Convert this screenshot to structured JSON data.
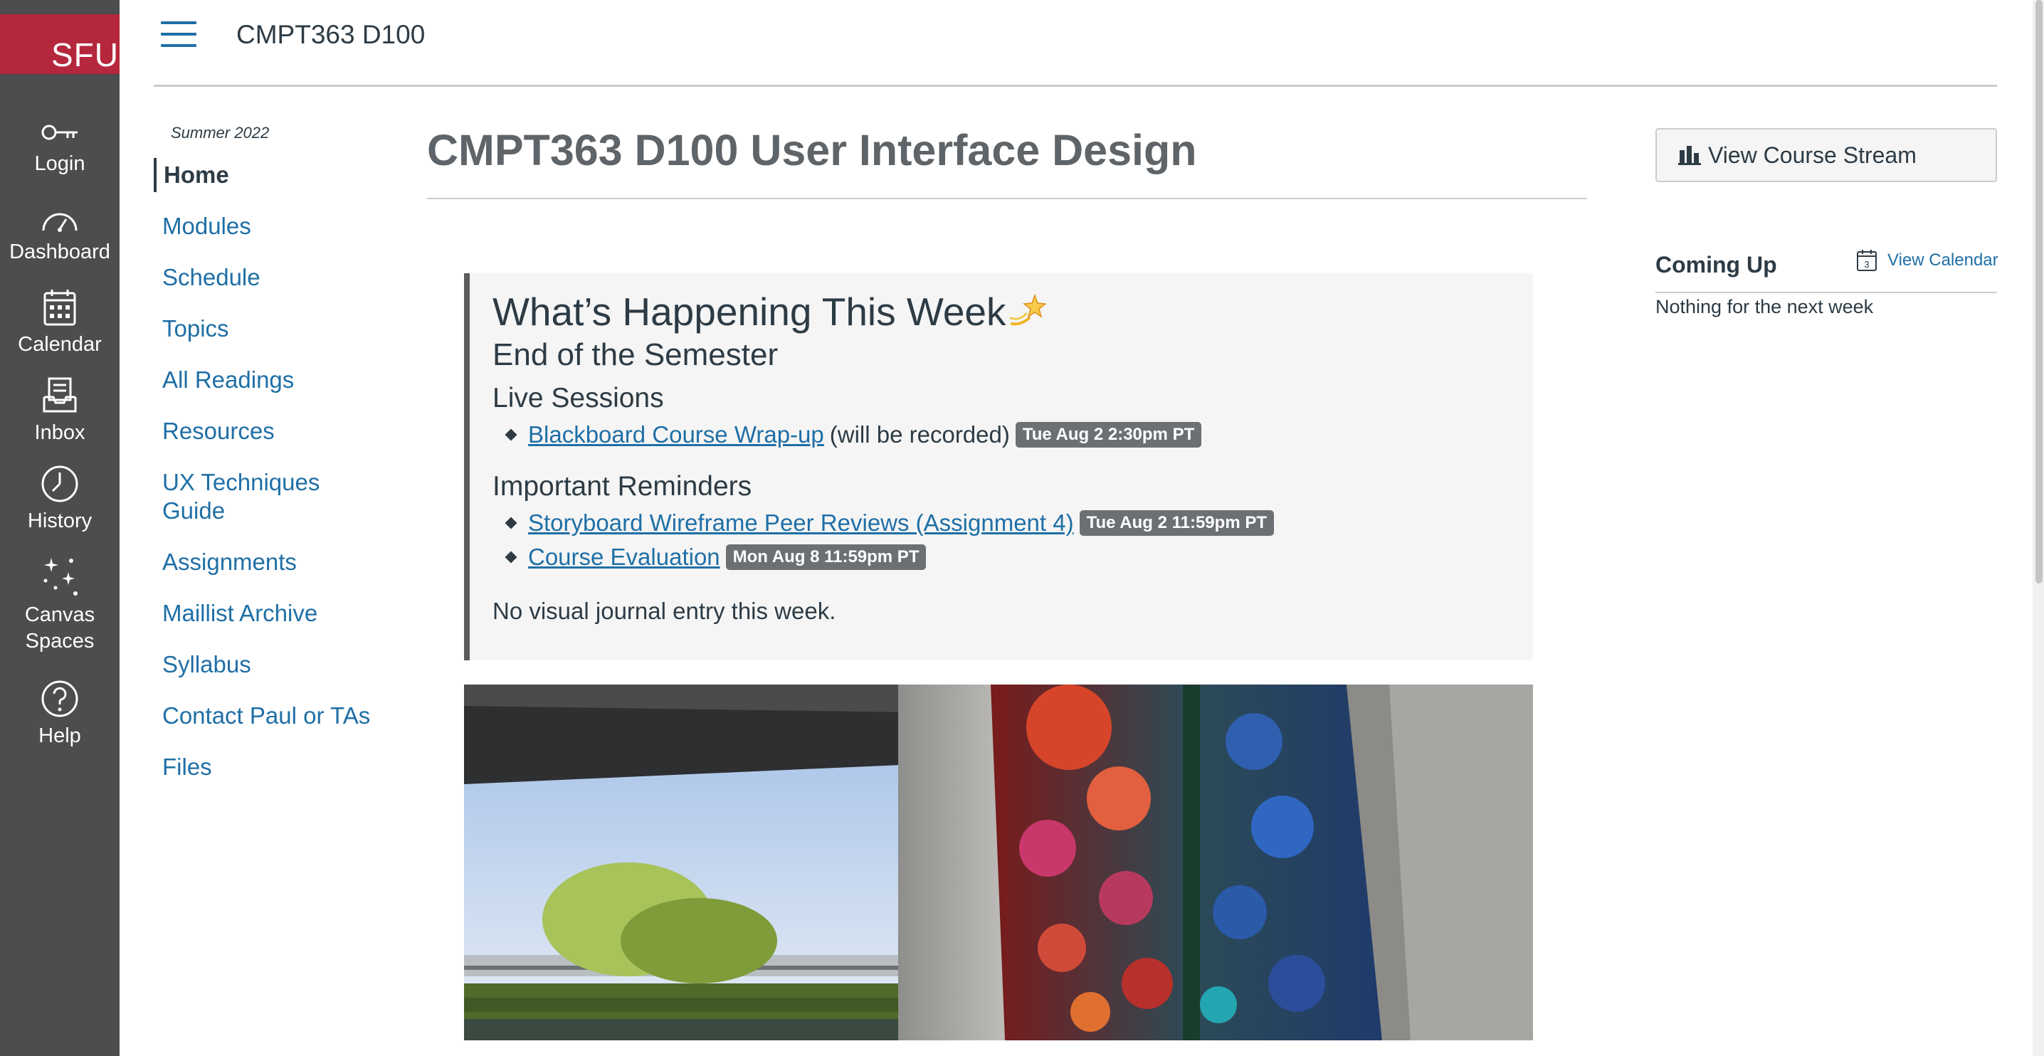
{
  "brand": {
    "logo_text": "SFU",
    "color": "#b5273d"
  },
  "global_nav": [
    {
      "label": "Login",
      "icon": "key-icon"
    },
    {
      "label": "Dashboard",
      "icon": "dashboard-icon"
    },
    {
      "label": "Calendar",
      "icon": "calendar-icon"
    },
    {
      "label": "Inbox",
      "icon": "inbox-icon"
    },
    {
      "label": "History",
      "icon": "clock-icon"
    },
    {
      "label": "Canvas\nSpaces",
      "label_line1": "Canvas",
      "label_line2": "Spaces",
      "icon": "sparkles-icon"
    },
    {
      "label": "Help",
      "icon": "help-icon"
    }
  ],
  "header": {
    "course_code": "CMPT363 D100"
  },
  "course_nav": {
    "term": "Summer 2022",
    "items": [
      {
        "label": "Home",
        "active": true
      },
      {
        "label": "Modules"
      },
      {
        "label": "Schedule"
      },
      {
        "label": "Topics"
      },
      {
        "label": "All Readings"
      },
      {
        "label": "Resources"
      },
      {
        "label": "UX Techniques",
        "label2": "Guide"
      },
      {
        "label": "Assignments"
      },
      {
        "label": "Maillist Archive"
      },
      {
        "label": "Syllabus"
      },
      {
        "label": "Contact Paul or TAs"
      },
      {
        "label": "Files"
      }
    ]
  },
  "main": {
    "page_title": "CMPT363 D100 User Interface Design",
    "week": {
      "heading": "What’s Happening This Week",
      "emoji": "dizzy-star-icon",
      "subheading": "End of the Semester",
      "live_sessions_heading": "Live Sessions",
      "live_sessions": [
        {
          "link": "Blackboard Course Wrap-up",
          "note": "(will be recorded)",
          "badge": "Tue Aug 2 2:30pm PT"
        }
      ],
      "reminders_heading": "Important Reminders",
      "reminders": [
        {
          "link": "Storyboard Wireframe Peer Reviews (Assignment 4)",
          "badge": "Tue Aug 2 11:59pm PT"
        },
        {
          "link": "Course Evaluation",
          "badge": "Mon Aug 8 11:59pm PT"
        }
      ],
      "journal": "No visual journal entry this week."
    }
  },
  "sidebar": {
    "stream_button": "View Course Stream",
    "coming_up": "Coming Up",
    "view_calendar": "View Calendar",
    "calendar_icon_day": "3",
    "nothing": "Nothing for the next week"
  },
  "colors": {
    "link": "#1f6fa6",
    "nav_bg": "#4b4d4f",
    "badge": "#6b7075"
  }
}
